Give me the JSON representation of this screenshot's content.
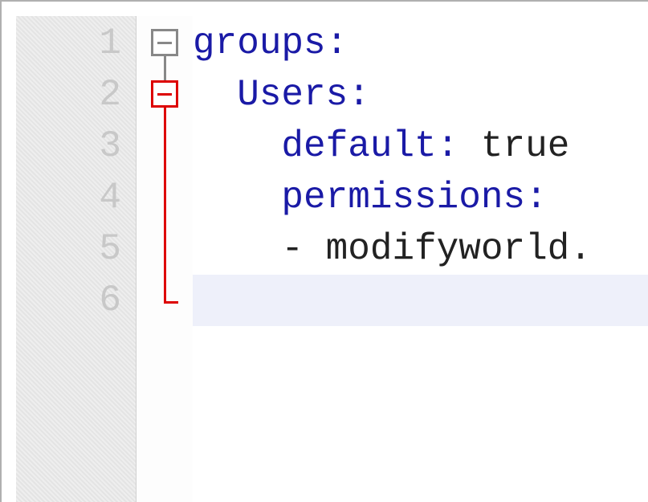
{
  "editor": {
    "line_numbers": [
      "1",
      "2",
      "3",
      "4",
      "5",
      "6"
    ],
    "highlighted_line_index": 5,
    "lines": {
      "l1_key": "groups",
      "l1_colon": ":",
      "l2_indent": "  ",
      "l2_key": "Users",
      "l2_colon": ":",
      "l3_indent": "    ",
      "l3_key": "default",
      "l3_colon": ": ",
      "l3_val": "true",
      "l4_indent": "    ",
      "l4_key": "permissions",
      "l4_colon": ":",
      "l5_indent": "    ",
      "l5_text": "- modifyworld."
    },
    "fold": {
      "box1_state": "expanded",
      "box2_state": "expanded"
    }
  }
}
